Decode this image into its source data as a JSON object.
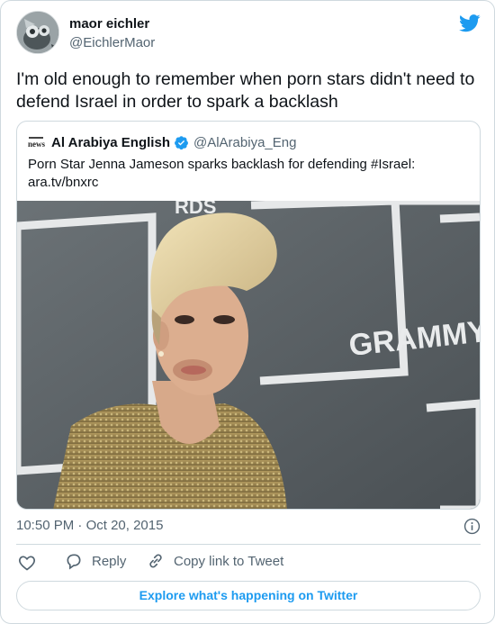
{
  "author": {
    "name": "maor eichler",
    "handle": "@EichlerMaor"
  },
  "tweet": {
    "text": "I'm old enough to remember when porn stars didn't need to defend Israel in order to spark a backlash"
  },
  "quoted_tweet": {
    "logo_text": "news",
    "name": "Al Arabiya English",
    "handle": "@AlArabiya_Eng",
    "text_line1": "Porn Star Jenna Jameson sparks backlash for defending #Israel:",
    "text_line2": "ara.tv/bnxrc",
    "image_backdrop_text": "GRAMMY",
    "image_backdrop_text_top": "RDS"
  },
  "meta": {
    "time": "10:50 PM",
    "separator": "·",
    "date": "Oct 20, 2015"
  },
  "actions": {
    "reply_label": "Reply",
    "copy_label": "Copy link to Tweet"
  },
  "explore": {
    "label": "Explore what's happening on Twitter"
  },
  "colors": {
    "accent": "#1d9bf0",
    "text": "#0f1419",
    "muted": "#536471",
    "border": "#cfd9de",
    "like": "#f91880"
  },
  "icons": {
    "brand": "twitter-bird-icon",
    "verified": "verified-badge-icon",
    "info": "info-icon",
    "like": "heart-icon",
    "reply": "reply-bubble-icon",
    "copy": "link-icon"
  }
}
